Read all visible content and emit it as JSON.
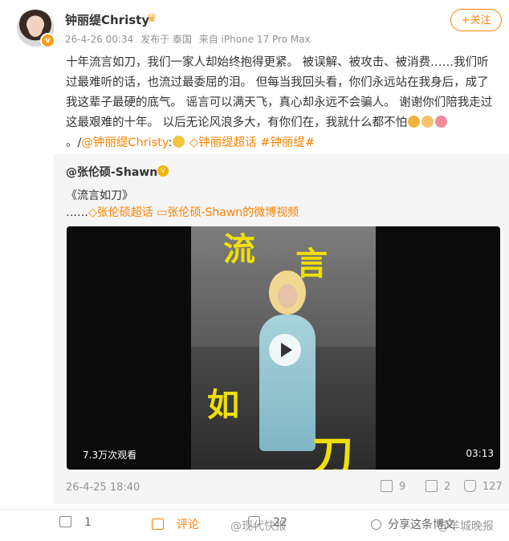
{
  "author": {
    "name": "钟丽缇Christy",
    "timestamp": "26-4-26 00:34",
    "source": "发布于 泰国",
    "device": "来自 iPhone 17 Pro Max"
  },
  "follow_label": "+关注",
  "post": {
    "text_1": "十年流言如刀，我们一家人却始终抱得更紧。 被误解、被攻击、被消费……我们听过最难听的话，也流过最委屈的泪。 但每当我回头看，你们永远站在我身后，成了我这辈子最硬的底气。 谣言可以满天飞，真心却永远不会骗人。 谢谢你们陪我走过这最艰难的十年。 以后无论风浪多大，有你们在，我就什么都不怕",
    "text_2": "。/",
    "mention": "@钟丽缇Christy",
    "text_3": ":",
    "topic_1": "钟丽缇超话",
    "topic_2": "#钟丽缇#"
  },
  "repost": {
    "user": "@张伦硕-Shawn",
    "title": "《流言如刀》",
    "prefix": "……",
    "topic": "张伦硕超话",
    "video_link": "张伦硕-Shawn的微博视频",
    "date": "26-4-25 18:40",
    "reposts": "9",
    "comments": "2",
    "likes": "127"
  },
  "video": {
    "views": "7.3万次观看",
    "duration": "03:13",
    "caption_chars": [
      "流",
      "言",
      "如",
      "刀"
    ]
  },
  "actions": {
    "share_count": "1",
    "comment_label": "评论",
    "like_count": "22",
    "share_label": "分享这条博文"
  },
  "watermarks": [
    "@现代快报",
    "@羊城晚报"
  ],
  "colors": {
    "accent": "#ff8200",
    "meta": "#939393",
    "repost_bg": "#f5f5f5"
  }
}
